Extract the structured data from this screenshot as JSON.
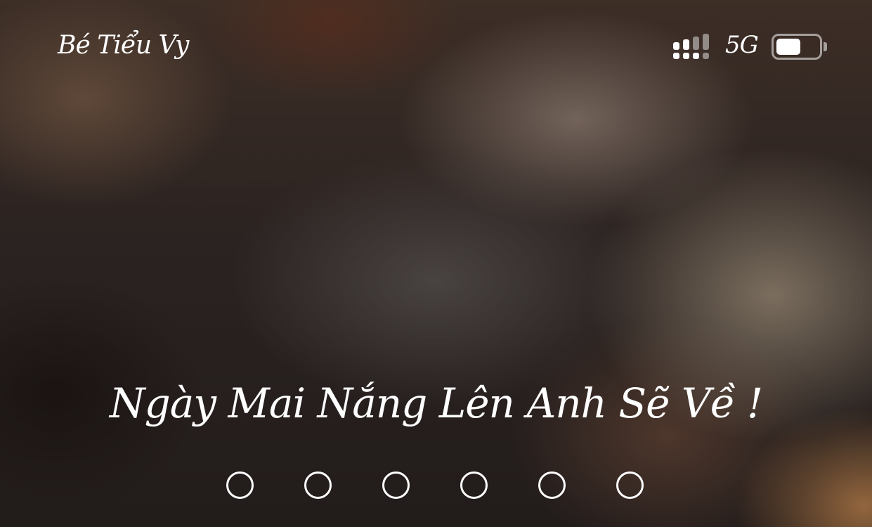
{
  "status_bar": {
    "carrier_name": "Bé Tiểu Vy",
    "network_type": "5G",
    "signal_icon": "cellular-signal-icon",
    "battery_icon": "battery-icon",
    "battery_level": 0.5
  },
  "lock_screen": {
    "message": "Ngày Mai Nắng Lên Anh Sẽ Về !",
    "passcode_length": 6,
    "passcode_entered": 0
  },
  "colors": {
    "text": "#ffffff",
    "icon_inactive": "#ffffff73"
  }
}
